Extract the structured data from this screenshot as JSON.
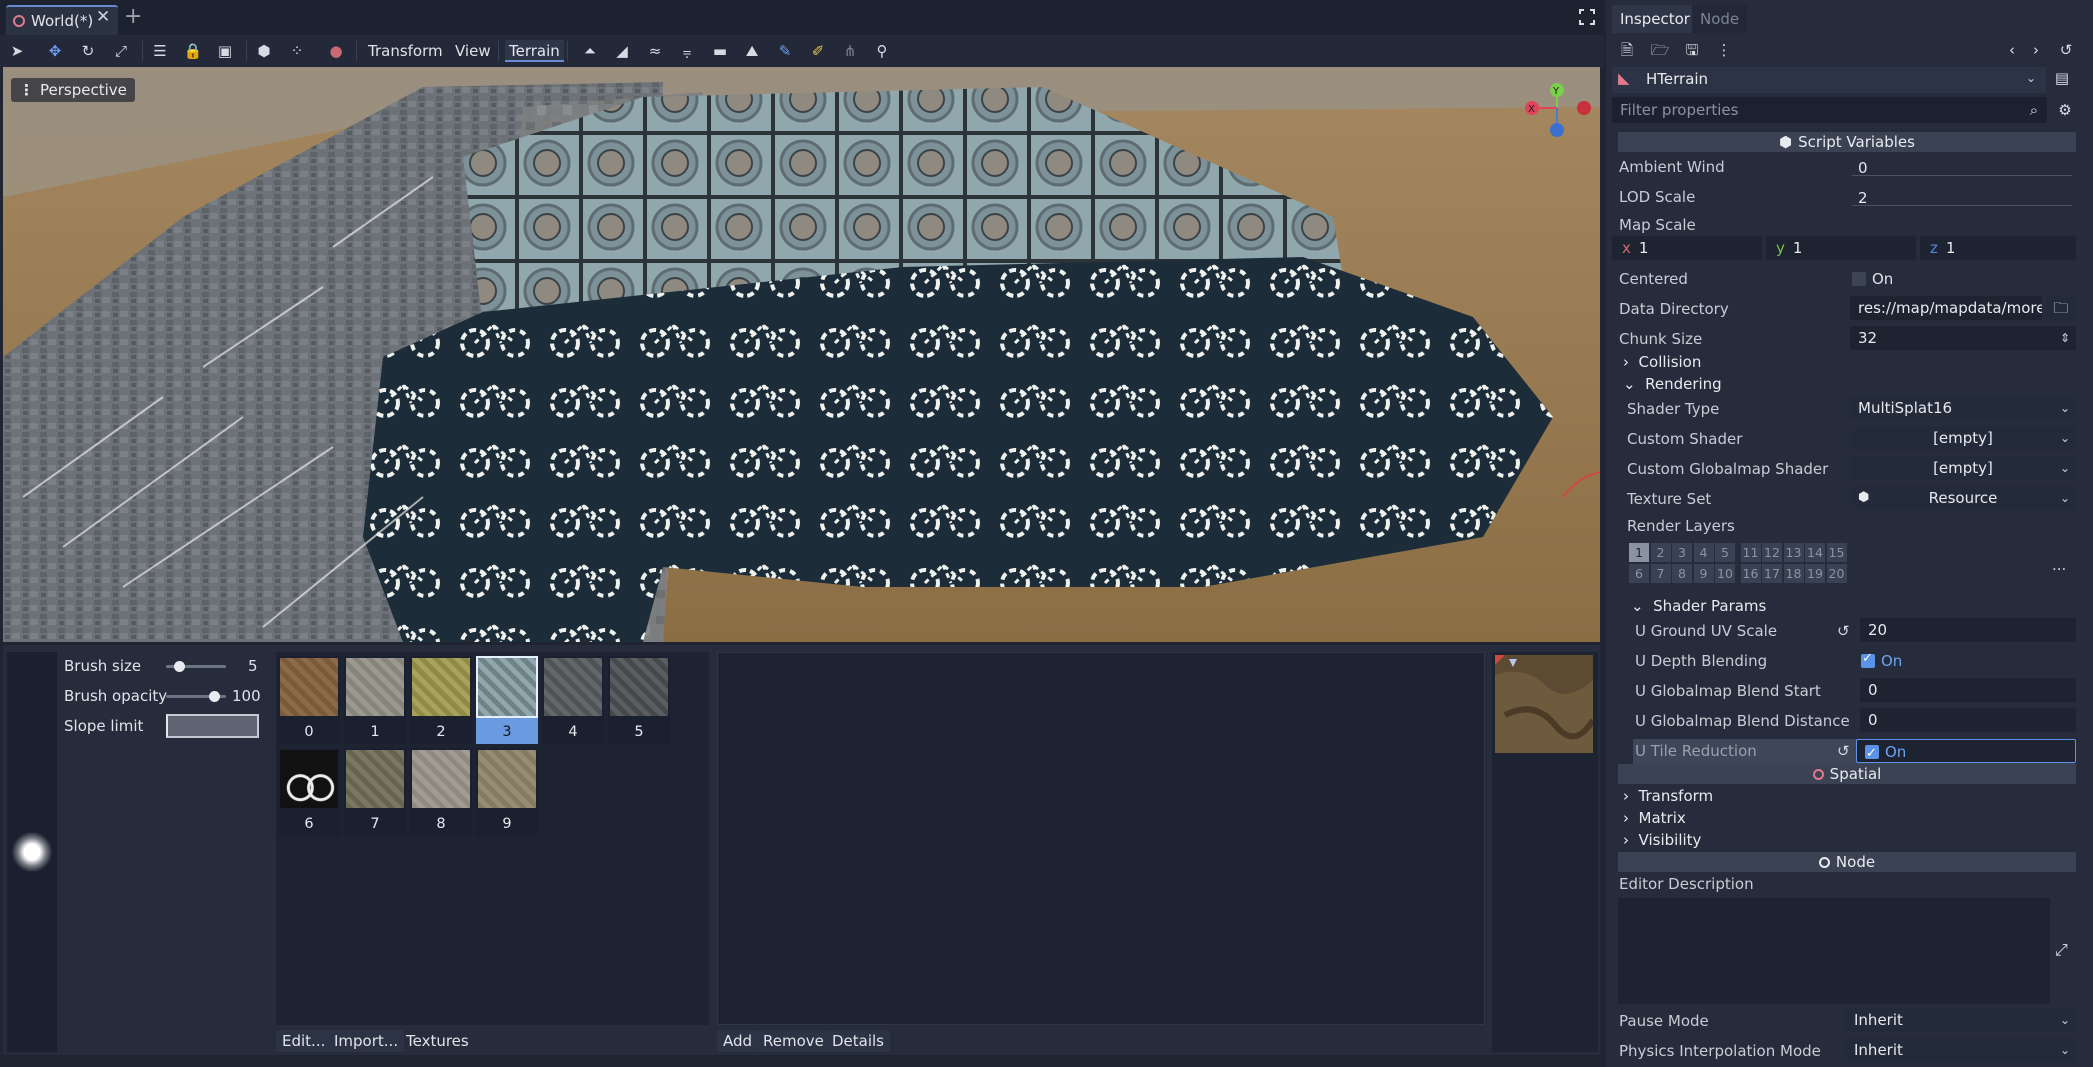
{
  "tabs": {
    "document": "World(*)"
  },
  "toolbar": {
    "transform": "Transform",
    "view": "View",
    "terrain": "Terrain"
  },
  "viewport": {
    "perspective": "Perspective",
    "gizmo": {
      "y": "Y",
      "x": "X"
    }
  },
  "brush": {
    "size_label": "Brush size",
    "size_value": "5",
    "opacity_label": "Brush opacity",
    "opacity_value": "100",
    "slope_label": "Slope limit"
  },
  "textures": {
    "items": [
      "0",
      "1",
      "2",
      "3",
      "4",
      "5",
      "6",
      "7",
      "8",
      "9"
    ],
    "selected": "3",
    "buttons": {
      "edit": "Edit...",
      "import": "Import...",
      "textures": "Textures"
    }
  },
  "detail_list": {
    "buttons": {
      "add": "Add",
      "remove": "Remove",
      "details": "Details"
    }
  },
  "inspector": {
    "tabs": {
      "inspector": "Inspector",
      "node": "Node"
    },
    "node_name": "HTerrain",
    "filter_placeholder": "Filter properties",
    "script_variables": "Script Variables",
    "props": {
      "ambient_wind": {
        "label": "Ambient Wind",
        "value": "0"
      },
      "lod_scale": {
        "label": "LOD Scale",
        "value": "2"
      },
      "map_scale": {
        "label": "Map Scale",
        "x_label": "x",
        "x": "1",
        "y_label": "y",
        "y": "1",
        "z_label": "z",
        "z": "1"
      },
      "centered": {
        "label": "Centered",
        "value": "On"
      },
      "data_directory": {
        "label": "Data Directory",
        "value": "res://map/mapdata/morew"
      },
      "chunk_size": {
        "label": "Chunk Size",
        "value": "32"
      }
    },
    "collision": "Collision",
    "rendering": {
      "label": "Rendering",
      "shader_type": {
        "label": "Shader Type",
        "value": "MultiSplat16"
      },
      "custom_shader": {
        "label": "Custom Shader",
        "value": "[empty]"
      },
      "custom_globalmap_shader": {
        "label": "Custom Globalmap Shader",
        "value": "[empty]"
      },
      "texture_set": {
        "label": "Texture Set",
        "value": "Resource"
      },
      "render_layers": {
        "label": "Render Layers",
        "row1": [
          "1",
          "2",
          "3",
          "4",
          "5",
          "11",
          "12",
          "13",
          "14",
          "15"
        ],
        "row2": [
          "6",
          "7",
          "8",
          "9",
          "10",
          "16",
          "17",
          "18",
          "19",
          "20"
        ],
        "more": "..."
      }
    },
    "shader_params": {
      "label": "Shader Params",
      "ground_uv_scale": {
        "label": "U Ground UV Scale",
        "value": "20"
      },
      "depth_blending": {
        "label": "U Depth Blending",
        "value": "On"
      },
      "globalmap_blend_start": {
        "label": "U Globalmap Blend Start",
        "value": "0"
      },
      "globalmap_blend_distance": {
        "label": "U Globalmap Blend Distance",
        "value": "0"
      },
      "tile_reduction": {
        "label": "U Tile Reduction",
        "value": "On"
      }
    },
    "spatial": "Spatial",
    "spatial_cats": {
      "transform": "Transform",
      "matrix": "Matrix",
      "visibility": "Visibility"
    },
    "node_section": "Node",
    "editor_description": "Editor Description",
    "pause_mode": {
      "label": "Pause Mode",
      "value": "Inherit"
    },
    "physics_interp": {
      "label": "Physics Interpolation Mode",
      "value": "Inherit"
    }
  },
  "colors": {
    "accent": "#6a9be0",
    "panel": "#262c3b",
    "background": "#202531"
  }
}
